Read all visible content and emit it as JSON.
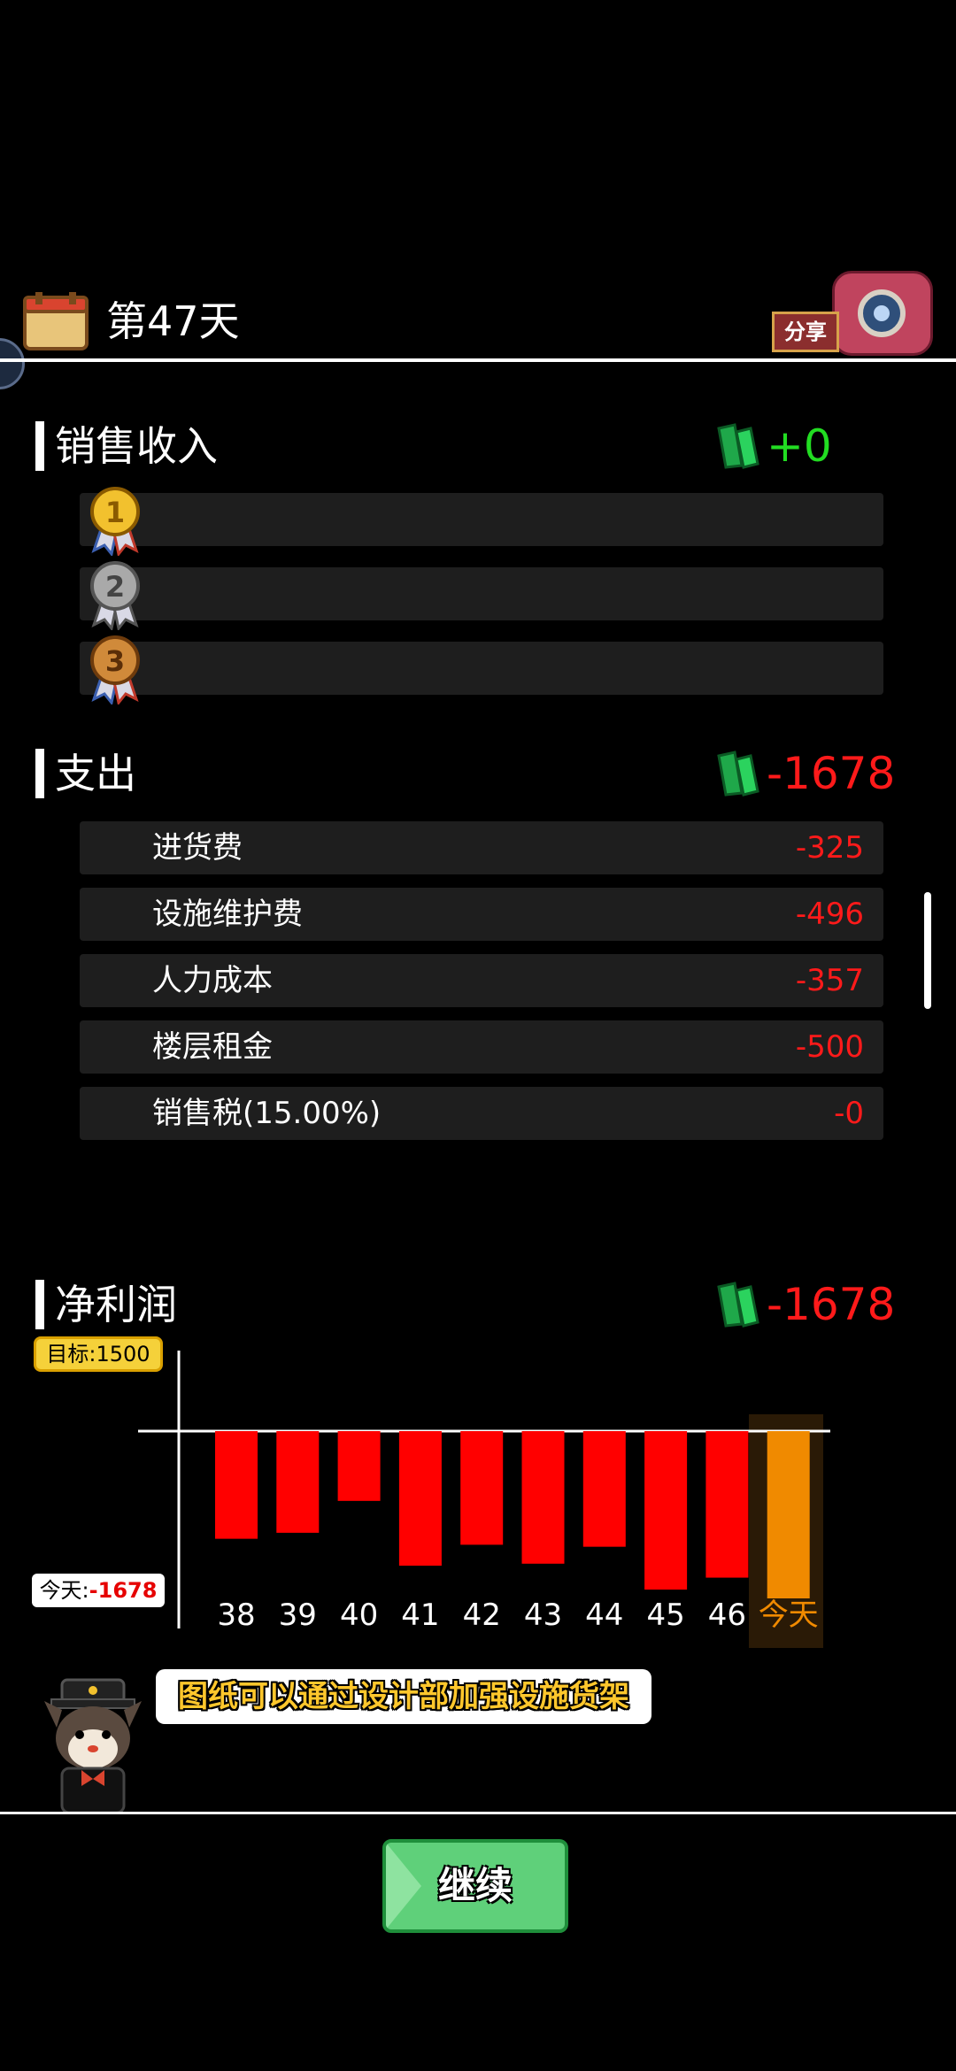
{
  "header": {
    "day_title": "第47天",
    "share_label": "分享"
  },
  "sales": {
    "title": "销售收入",
    "value": "+0",
    "ranks": [
      {
        "medal": "1",
        "name": ""
      },
      {
        "medal": "2",
        "name": ""
      },
      {
        "medal": "3",
        "name": ""
      }
    ]
  },
  "expenses": {
    "title": "支出",
    "value": "-1678",
    "items": [
      {
        "label": "进货费",
        "value": "-325"
      },
      {
        "label": "设施维护费",
        "value": "-496"
      },
      {
        "label": "人力成本",
        "value": "-357"
      },
      {
        "label": "楼层租金",
        "value": "-500"
      },
      {
        "label": "销售税(15.00%)",
        "value": "-0"
      }
    ]
  },
  "profit": {
    "title": "净利润",
    "value": "-1678",
    "target_label": "目标:1500",
    "today_label": "今天:",
    "today_value": "-1678"
  },
  "chart_data": {
    "type": "bar",
    "categories": [
      "38",
      "39",
      "40",
      "41",
      "42",
      "43",
      "44",
      "45",
      "46",
      "今天"
    ],
    "values": [
      -1080,
      -1020,
      -700,
      -1350,
      -1140,
      -1330,
      -1160,
      -1590,
      -1470,
      -1678
    ],
    "highlight_index": 9,
    "target": 1500,
    "colors": {
      "bar": "#ff0000",
      "highlight": "#f08a00",
      "label": "#ffffff",
      "highlight_label": "#f08a00"
    }
  },
  "tip": {
    "text": "图纸可以通过设计部加强设施货架"
  },
  "continue_button": {
    "label": "继续"
  },
  "colors": {
    "positive": "#22dd22",
    "negative": "#ff1a1a",
    "accent": "#ffc72c"
  }
}
